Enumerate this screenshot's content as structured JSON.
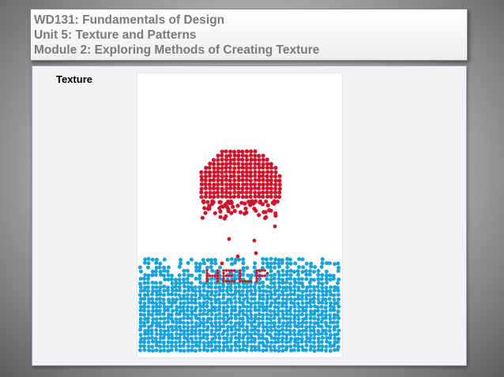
{
  "header": {
    "lines": [
      "WD131: Fundamentals of Design",
      "Unit 5: Texture and Patterns",
      "Module 2: Exploring Methods of Creating Texture"
    ]
  },
  "content": {
    "section_label": "Texture",
    "image": {
      "word": "HELP",
      "colors": {
        "sun": "#d0142c",
        "water": "#1aa3d8",
        "background": "#ffffff"
      }
    }
  }
}
